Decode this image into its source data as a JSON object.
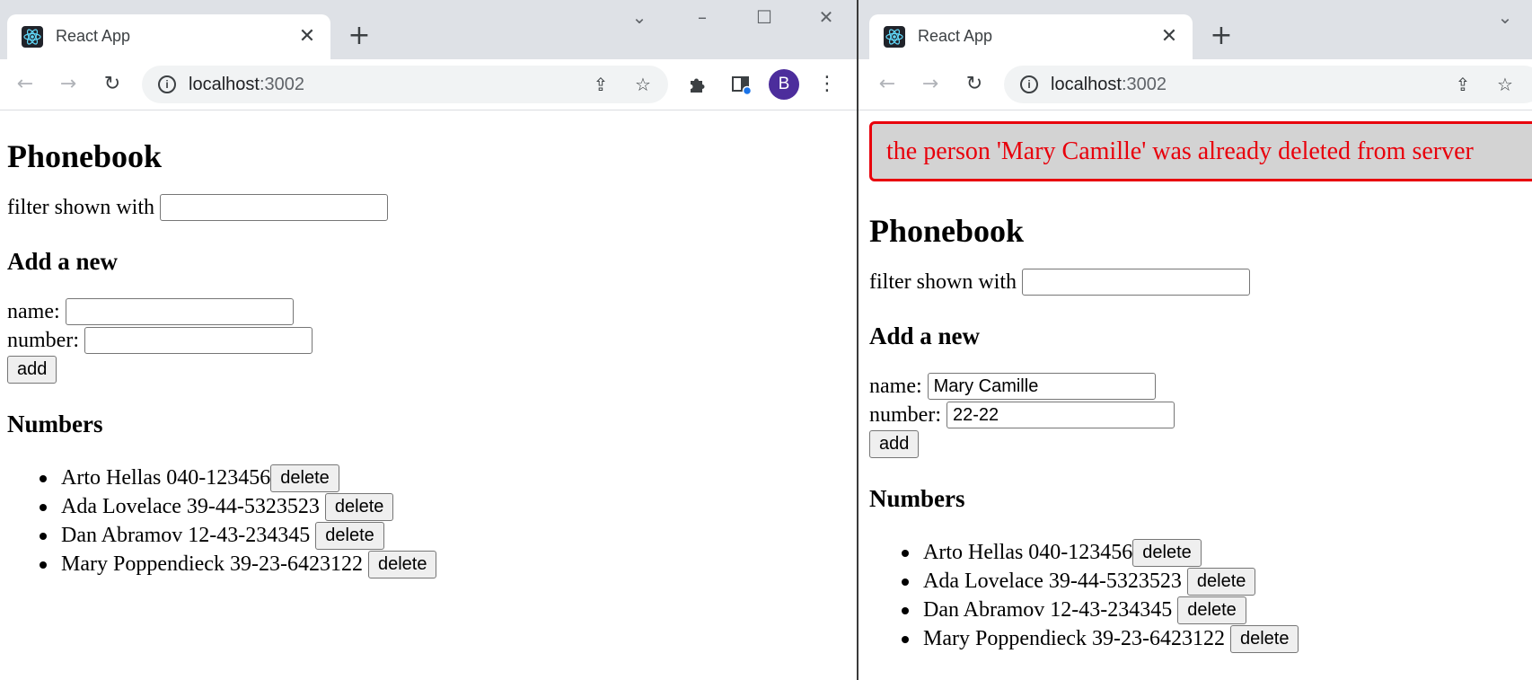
{
  "colors": {
    "tab_strip": "#dee1e6",
    "avatar_bg": "#4c2d9c",
    "notification_border": "#e8000b",
    "notification_bg": "#d3d3d3",
    "notification_text": "#e8000b"
  },
  "icons": {
    "favicon": "react-atom-icon",
    "tab_close": "close-icon",
    "new_tab": "plus-icon",
    "back": "arrow-left-icon",
    "forward": "arrow-right-icon",
    "reload": "reload-icon",
    "site_info": "info-icon",
    "share": "share-icon",
    "bookmark": "star-icon",
    "extensions": "puzzle-icon",
    "side_panel": "side-panel-icon",
    "menu": "kebab-menu-icon",
    "tab_search": "chevron-down-icon",
    "minimize": "minimize-icon",
    "maximize": "maximize-icon",
    "window_close": "close-icon"
  },
  "left": {
    "browser": {
      "tab_title": "React App",
      "url_host": "localhost",
      "url_port": ":3002",
      "avatar_letter": "B"
    },
    "app": {
      "title": "Phonebook",
      "filter_label": "filter shown with",
      "filter_value": "",
      "add_heading": "Add a new",
      "name_label": "name:",
      "name_value": "",
      "number_label": "number:",
      "number_value": "",
      "add_button": "add",
      "numbers_heading": "Numbers",
      "persons": [
        {
          "text": "Arto Hellas 040-123456",
          "button": "delete"
        },
        {
          "text": "Ada Lovelace 39-44-5323523",
          "button": "delete"
        },
        {
          "text": "Dan Abramov 12-43-234345",
          "button": "delete"
        },
        {
          "text": "Mary Poppendieck 39-23-6423122",
          "button": "delete"
        }
      ]
    }
  },
  "right": {
    "browser": {
      "tab_title": "React App",
      "url_host": "localhost",
      "url_port": ":3002"
    },
    "app": {
      "notification": "the person 'Mary Camille' was already deleted from server",
      "title": "Phonebook",
      "filter_label": "filter shown with",
      "filter_value": "",
      "add_heading": "Add a new",
      "name_label": "name:",
      "name_value": "Mary Camille",
      "number_label": "number:",
      "number_value": "22-22",
      "add_button": "add",
      "numbers_heading": "Numbers",
      "persons": [
        {
          "text": "Arto Hellas 040-123456",
          "button": "delete"
        },
        {
          "text": "Ada Lovelace 39-44-5323523",
          "button": "delete"
        },
        {
          "text": "Dan Abramov 12-43-234345",
          "button": "delete"
        },
        {
          "text": "Mary Poppendieck 39-23-6423122",
          "button": "delete"
        }
      ]
    }
  }
}
